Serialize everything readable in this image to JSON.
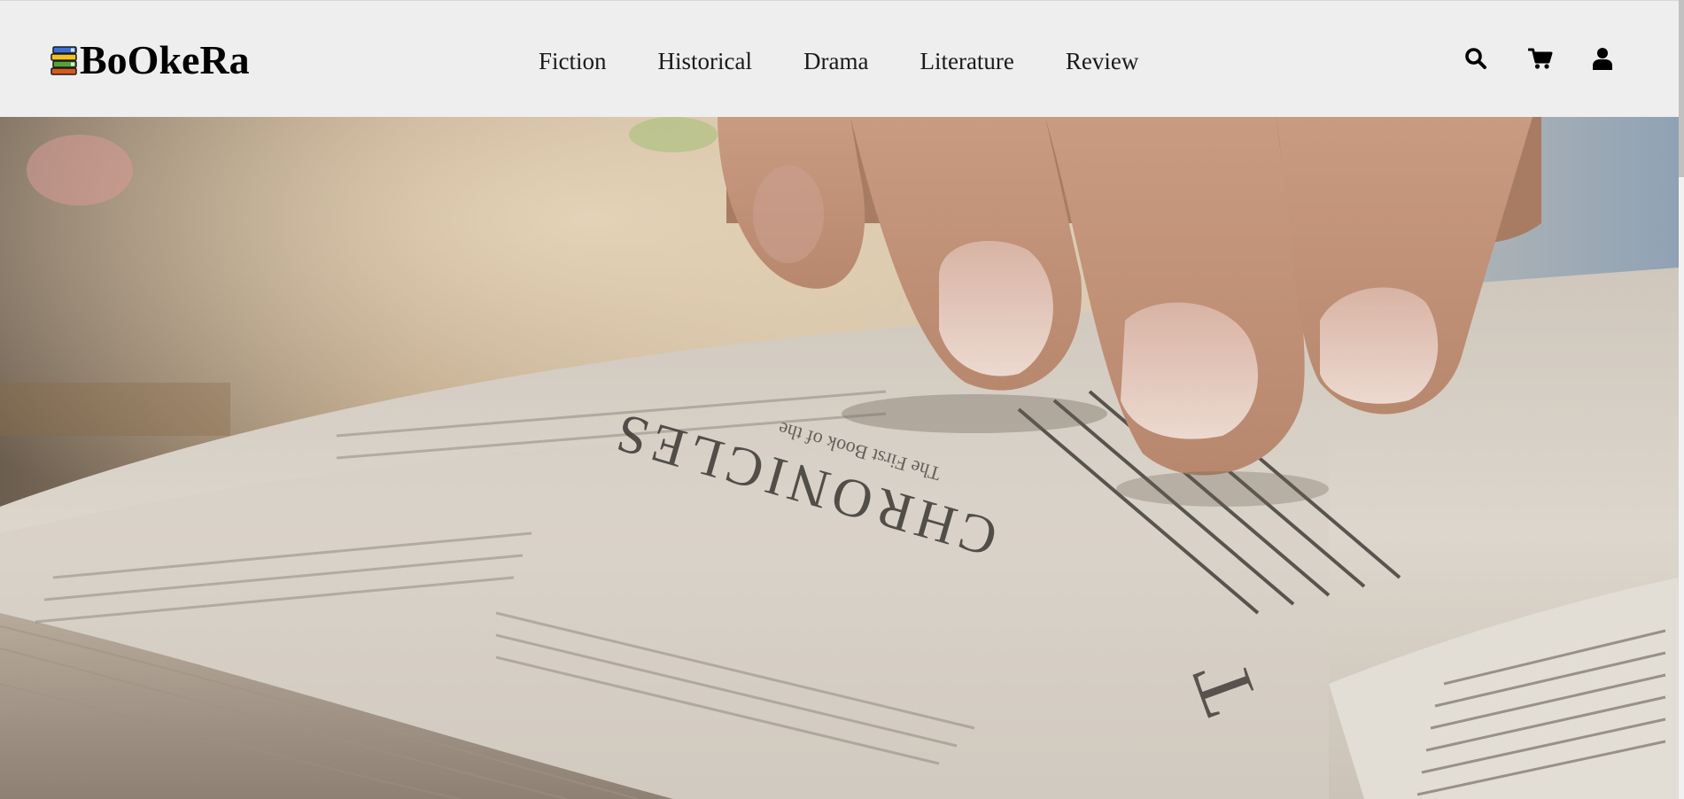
{
  "brand": {
    "name": "BoOkeRa",
    "logo_icon": "stacked-books-icon"
  },
  "nav": {
    "items": [
      {
        "label": "Fiction"
      },
      {
        "label": "Historical"
      },
      {
        "label": "Drama"
      },
      {
        "label": "Literature"
      },
      {
        "label": "Review"
      }
    ]
  },
  "actions": {
    "search_icon": "search-icon",
    "cart_icon": "cart-icon",
    "account_icon": "user-icon"
  },
  "hero": {
    "image_subject": "hand-on-open-book",
    "book_heading": "CHRONICLES",
    "book_subheading": "The First Book of the"
  },
  "colors": {
    "header_bg": "#eeeeee",
    "text": "#000000"
  }
}
